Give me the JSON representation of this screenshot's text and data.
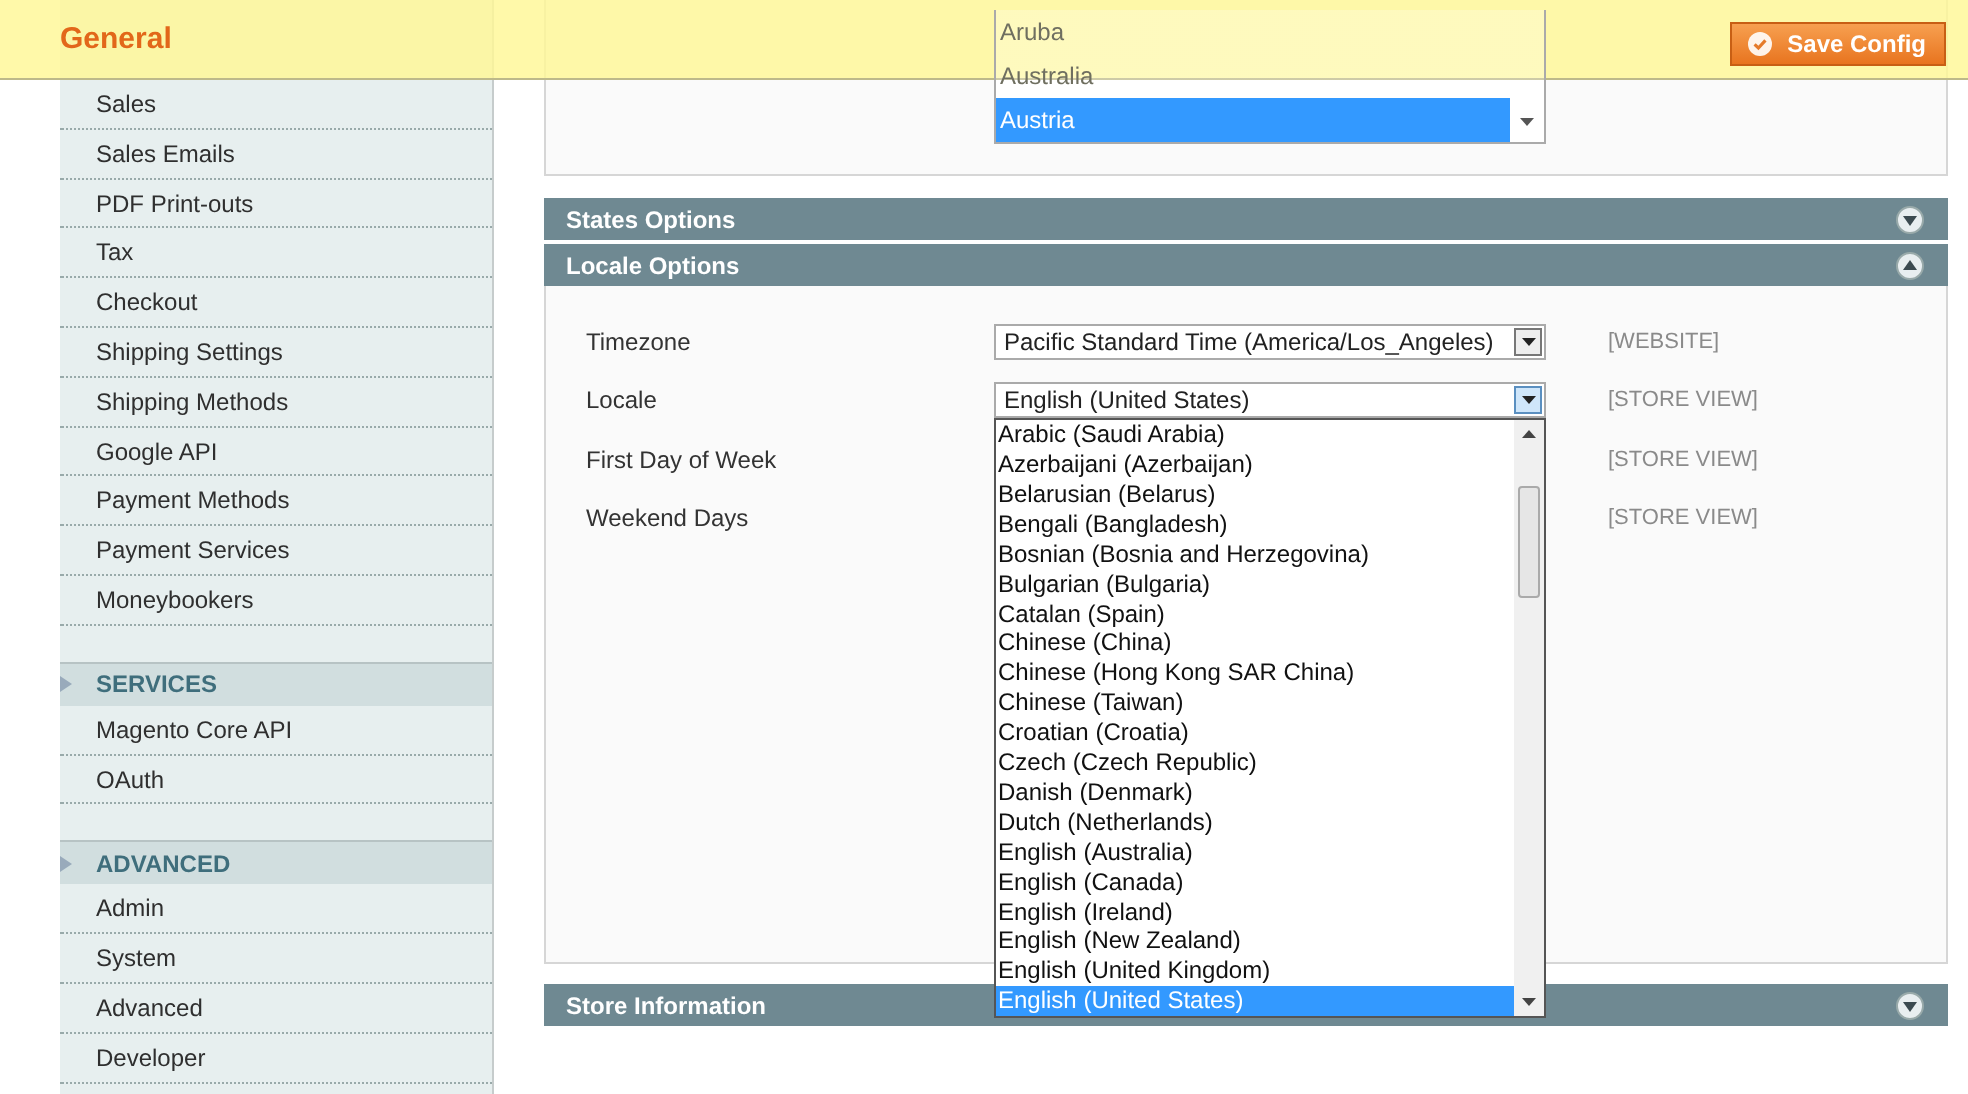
{
  "header": {
    "title": "General",
    "save_button": "Save Config"
  },
  "sidebar": {
    "groups": [
      {
        "items": [
          "Sales",
          "Sales Emails",
          "PDF Print-outs",
          "Tax",
          "Checkout",
          "Shipping Settings",
          "Shipping Methods",
          "Google API",
          "Payment Methods",
          "Payment Services",
          "Moneybookers"
        ]
      },
      {
        "title": "SERVICES",
        "items": [
          "Magento Core API",
          "OAuth"
        ]
      },
      {
        "title": "ADVANCED",
        "items": [
          "Admin",
          "System",
          "Advanced",
          "Developer"
        ]
      }
    ]
  },
  "country_list": {
    "options": [
      {
        "label": "Aruba",
        "selected": false
      },
      {
        "label": "Australia",
        "selected": false
      },
      {
        "label": "Austria",
        "selected": true
      }
    ]
  },
  "sections": [
    {
      "title": "States Options",
      "expanded": false
    },
    {
      "title": "Locale Options",
      "expanded": true,
      "fields": [
        {
          "label": "Timezone",
          "value": "Pacific Standard Time (America/Los_Angeles)",
          "scope": "[WEBSITE]"
        },
        {
          "label": "Locale",
          "value": "English (United States)",
          "scope": "[STORE VIEW]",
          "options": [
            {
              "label": "Arabic (Saudi Arabia)",
              "selected": false
            },
            {
              "label": "Azerbaijani (Azerbaijan)",
              "selected": false
            },
            {
              "label": "Belarusian (Belarus)",
              "selected": false
            },
            {
              "label": "Bengali (Bangladesh)",
              "selected": false
            },
            {
              "label": "Bosnian (Bosnia and Herzegovina)",
              "selected": false
            },
            {
              "label": "Bulgarian (Bulgaria)",
              "selected": false
            },
            {
              "label": "Catalan (Spain)",
              "selected": false
            },
            {
              "label": "Chinese (China)",
              "selected": false
            },
            {
              "label": "Chinese (Hong Kong SAR China)",
              "selected": false
            },
            {
              "label": "Chinese (Taiwan)",
              "selected": false
            },
            {
              "label": "Croatian (Croatia)",
              "selected": false
            },
            {
              "label": "Czech (Czech Republic)",
              "selected": false
            },
            {
              "label": "Danish (Denmark)",
              "selected": false
            },
            {
              "label": "Dutch (Netherlands)",
              "selected": false
            },
            {
              "label": "English (Australia)",
              "selected": false
            },
            {
              "label": "English (Canada)",
              "selected": false
            },
            {
              "label": "English (Ireland)",
              "selected": false
            },
            {
              "label": "English (New Zealand)",
              "selected": false
            },
            {
              "label": "English (United Kingdom)",
              "selected": false
            },
            {
              "label": "English (United States)",
              "selected": true
            }
          ]
        },
        {
          "label": "First Day of Week",
          "scope": "[STORE VIEW]"
        },
        {
          "label": "Weekend Days",
          "scope": "[STORE VIEW]"
        }
      ]
    },
    {
      "title": "Store Information",
      "expanded": false
    }
  ]
}
